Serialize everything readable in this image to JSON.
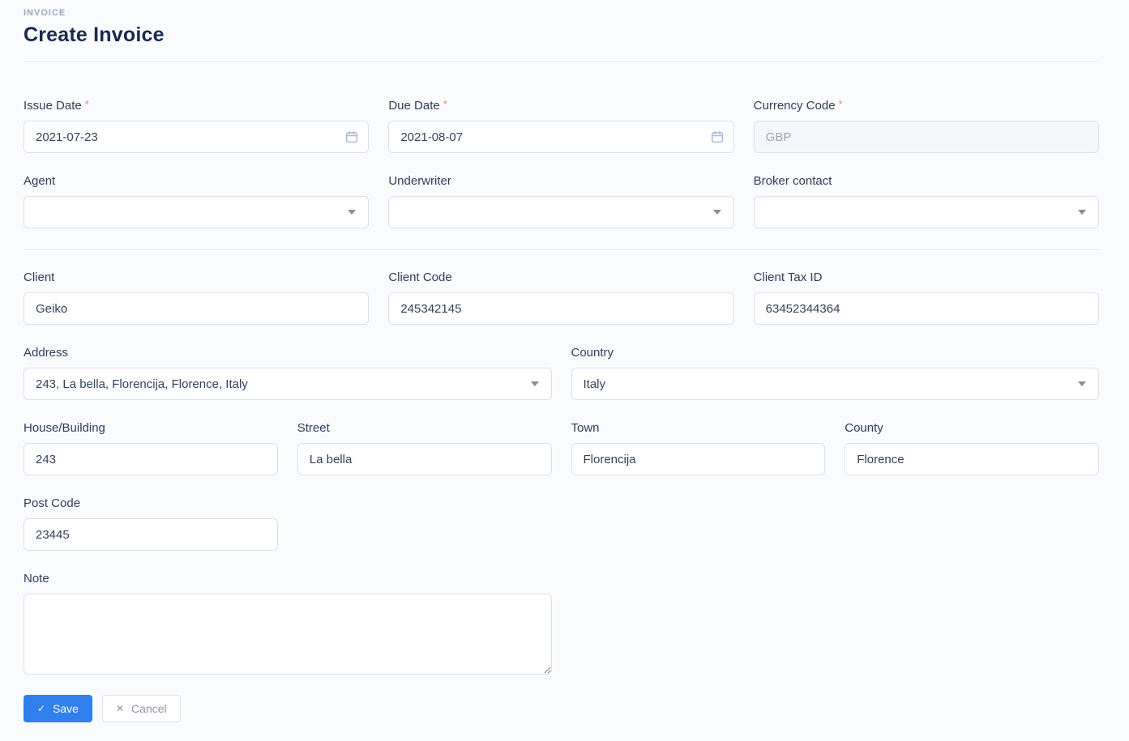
{
  "page": {
    "eyebrow": "INVOICE",
    "title": "Create Invoice"
  },
  "fields": {
    "issue_date": {
      "label": "Issue Date",
      "required": "*",
      "value": "2021-07-23"
    },
    "due_date": {
      "label": "Due Date",
      "required": "*",
      "value": "2021-08-07"
    },
    "currency_code": {
      "label": "Currency Code",
      "required": "*",
      "value": "GBP"
    },
    "agent": {
      "label": "Agent",
      "value": ""
    },
    "underwriter": {
      "label": "Underwriter",
      "value": ""
    },
    "broker_contact": {
      "label": "Broker contact",
      "value": ""
    },
    "client": {
      "label": "Client",
      "value": "Geiko"
    },
    "client_code": {
      "label": "Client Code",
      "value": "245342145"
    },
    "client_tax_id": {
      "label": "Client Tax ID",
      "value": "63452344364"
    },
    "address": {
      "label": "Address",
      "value": "243, La bella, Florencija, Florence, Italy"
    },
    "country": {
      "label": "Country",
      "value": "Italy"
    },
    "house_building": {
      "label": "House/Building",
      "value": "243"
    },
    "street": {
      "label": "Street",
      "value": "La bella"
    },
    "town": {
      "label": "Town",
      "value": "Florencija"
    },
    "county": {
      "label": "County",
      "value": "Florence"
    },
    "post_code": {
      "label": "Post Code",
      "value": "23445"
    },
    "note": {
      "label": "Note",
      "value": ""
    }
  },
  "buttons": {
    "save": "Save",
    "cancel": "Cancel"
  },
  "icons": {
    "save_check": "✓",
    "cancel_x": "✕"
  },
  "colors": {
    "accent": "#2f80ed",
    "required": "#ee7e72",
    "page_bg": "#fafbfd",
    "border": "#d9e0ee",
    "label": "#2e3d59",
    "eyebrow": "#9aa8bf",
    "disabled_bg": "#f5f7fa"
  }
}
